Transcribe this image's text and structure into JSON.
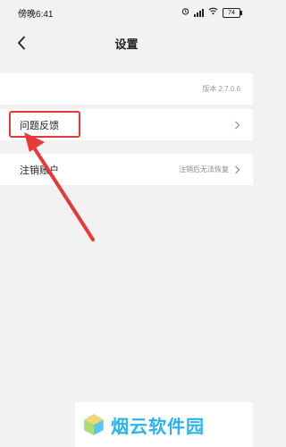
{
  "status_bar": {
    "time": "傍晚6:41",
    "battery": "74"
  },
  "header": {
    "title": "设置"
  },
  "settings": {
    "version_row": {
      "value": "版本 2.7.0.6"
    },
    "feedback_row": {
      "label": "问题反馈"
    },
    "cancel_account_row": {
      "label": "注销账户",
      "value": "注销后无法恢复"
    }
  },
  "annotation": {
    "highlight_color": "#e53a36"
  },
  "watermark": {
    "text": "烟云软件园",
    "color": "#2bb3f0"
  },
  "icons": {
    "back": "chevron-left-icon",
    "forward": "chevron-right-icon",
    "wifi": "wifi-icon",
    "signal": "signal-icon",
    "battery": "battery-icon",
    "alarm": "alarm-icon"
  }
}
